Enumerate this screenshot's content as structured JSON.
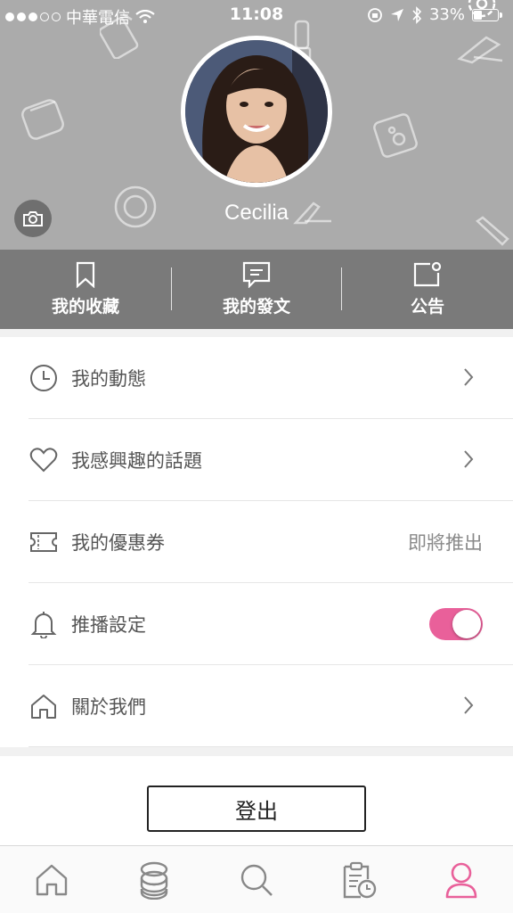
{
  "status_bar": {
    "carrier": "中華電信",
    "time": "11:08",
    "battery": "33%"
  },
  "profile": {
    "username": "Cecilia"
  },
  "actions": [
    {
      "label": "我的收藏",
      "icon": "bookmark-icon"
    },
    {
      "label": "我的發文",
      "icon": "message-icon"
    },
    {
      "label": "公告",
      "icon": "notification-icon"
    }
  ],
  "menu": {
    "activity": "我的動態",
    "interests": "我感興趣的話題",
    "coupons": "我的優惠券",
    "coupons_status": "即將推出",
    "push": "推播設定",
    "push_enabled": true,
    "about": "關於我們"
  },
  "logout_label": "登出",
  "colors": {
    "accent": "#e9609a",
    "header_bg": "#ababab",
    "action_bar_bg": "#7a7a7a"
  },
  "tabs": [
    {
      "icon": "home-icon",
      "active": false
    },
    {
      "icon": "compact-powder-icon",
      "active": false
    },
    {
      "icon": "search-icon",
      "active": false
    },
    {
      "icon": "calendar-clock-icon",
      "active": false
    },
    {
      "icon": "user-icon",
      "active": true
    }
  ]
}
